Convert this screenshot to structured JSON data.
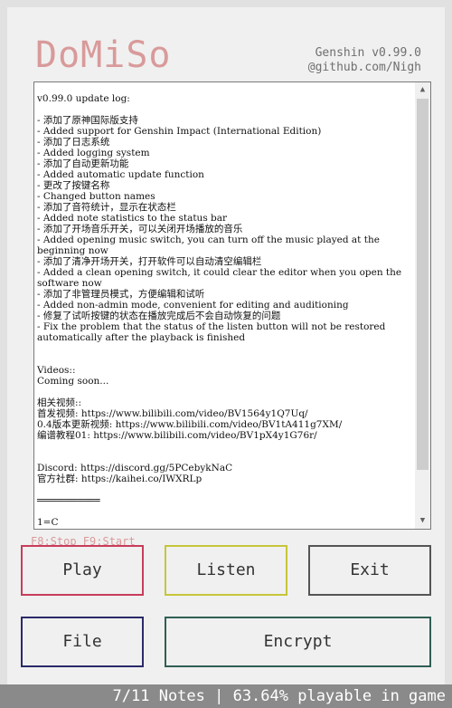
{
  "app": {
    "brand": "DoMiSo",
    "version": "Genshin v0.99.0",
    "repo": "@github.com/Nigh"
  },
  "log": {
    "text": "v0.99.0 update log:\n\n- 添加了原神国际版支持\n- Added support for Genshin Impact (International Edition)\n- 添加了日志系统\n- Added logging system\n- 添加了自动更新功能\n- Added automatic update function\n- 更改了按键名称\n- Changed button names\n- 添加了音符统计，显示在状态栏\n- Added note statistics to the status bar\n- 添加了开场音乐开关，可以关闭开场播放的音乐\n- Added opening music switch, you can turn off the music played at the beginning now\n- 添加了清净开场开关，打开软件可以自动清空编辑栏\n- Added a clean opening switch, it could clear the editor when you open the software now\n- 添加了非管理员模式，方便编辑和试听\n- Added non-admin mode, convenient for editing and auditioning\n- 修复了试听按键的状态在播放完成后不会自动恢复的问题\n- Fix the problem that the status of the listen button will not be restored automatically after the playback is finished\n\n\nVideos::\nComing soon...\n\n相关视频::\n首发视频: https://www.bilibili.com/video/BV1564y1Q7Uq/\n0.4版本更新视频: https://www.bilibili.com/video/BV1tA411g7XM/\n编谱教程01: https://www.bilibili.com/video/BV1pX4y1G76r/\n\n\nDiscord: https://discord.gg/5PCebykNaC\n官方社群: https://kaihei.co/IWXRLp\n\n═══════════\n\n1=C"
  },
  "scrollbar": {
    "up": "▲",
    "down": "▼"
  },
  "hotkeys": "F8:Stop F9:Start",
  "buttons": {
    "play": "Play",
    "listen": "Listen",
    "exit": "Exit",
    "file": "File",
    "encrypt": "Encrypt"
  },
  "status": "7/11 Notes | 63.64% playable in game"
}
